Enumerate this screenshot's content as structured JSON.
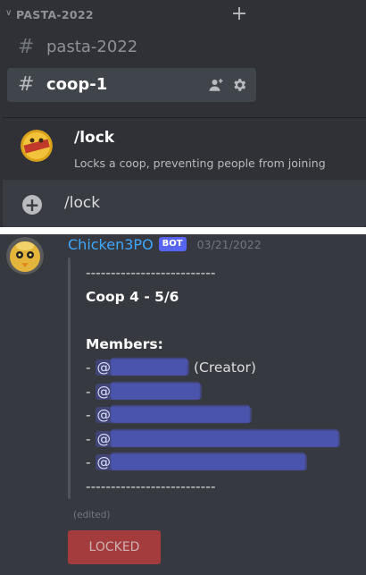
{
  "sidebar": {
    "category": "PASTA-2022",
    "channels": [
      {
        "name": "pasta-2022"
      },
      {
        "name": "coop-1"
      }
    ]
  },
  "autocomplete": {
    "command": "/lock",
    "description": "Locks a coop, preventing people from joining",
    "input_value": "/lock"
  },
  "message": {
    "username": "Chicken3PO",
    "bot_tag": "BOT",
    "timestamp": "03/21/2022",
    "separator": "--------------------------",
    "title": "Coop 4 - 5/6",
    "members_label": "Members:",
    "members": [
      {
        "prefix": "- ",
        "at": "@",
        "suffix": "(Creator)"
      },
      {
        "prefix": "- ",
        "at": "@",
        "suffix": ""
      },
      {
        "prefix": "- ",
        "at": "@",
        "suffix": ""
      },
      {
        "prefix": "- ",
        "at": "@",
        "suffix": ""
      },
      {
        "prefix": "- ",
        "at": "@",
        "suffix": ""
      }
    ],
    "edited": "(edited)",
    "button_label": "LOCKED"
  },
  "colors": {
    "username": "#3ea8ff",
    "bot_tag": "#5865f2",
    "locked_button": "#b83c3c"
  }
}
